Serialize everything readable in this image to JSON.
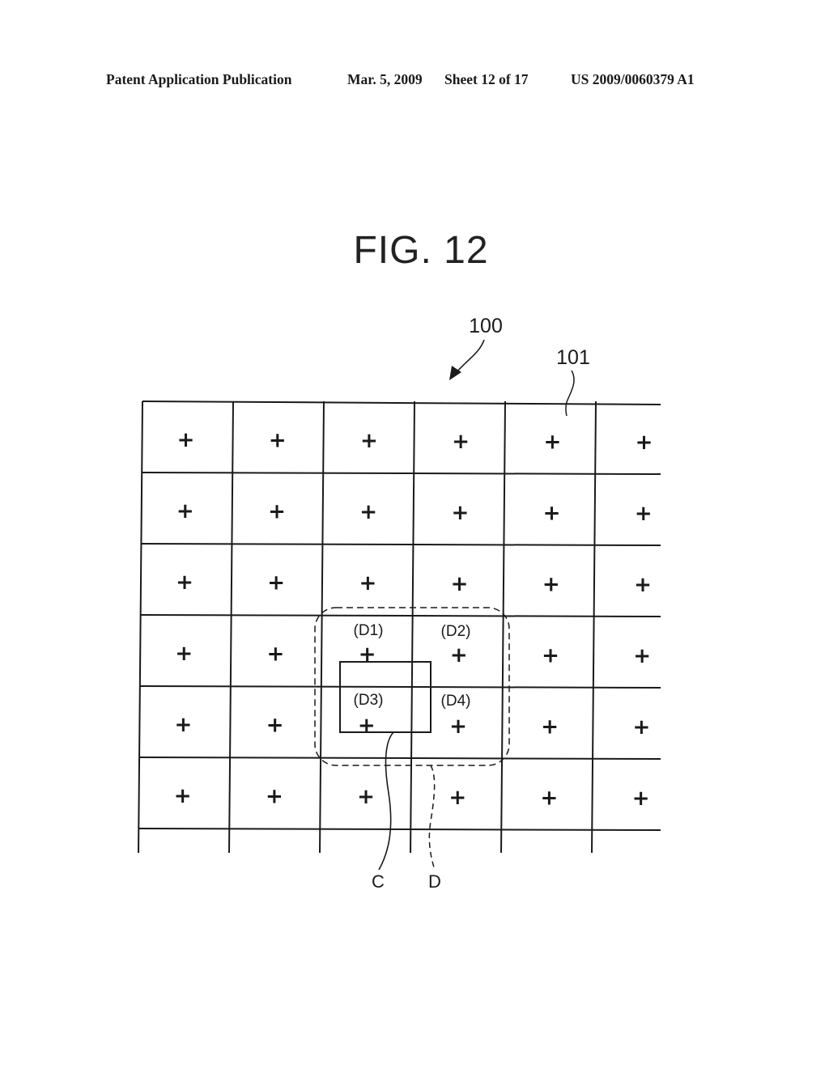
{
  "header": {
    "publication": "Patent Application Publication",
    "date": "Mar. 5, 2009",
    "sheet": "Sheet 12 of 17",
    "number": "US 2009/0060379 A1"
  },
  "figure": {
    "title": "FIG. 12",
    "grid": {
      "rows": 6,
      "columns": 6,
      "cell_marker": "+",
      "extends_beyond_right_edge": true,
      "extends_beyond_bottom_edge": true
    },
    "reference_labels": {
      "device": "100",
      "pixel_cell": "101",
      "region_c": "C",
      "region_d": "D"
    },
    "cell_labels": [
      {
        "text": "(D1)",
        "row": 4,
        "column": 3
      },
      {
        "text": "(D2)",
        "row": 4,
        "column": 4
      },
      {
        "text": "(D3)",
        "row": 5,
        "column": 3
      },
      {
        "text": "(D4)",
        "row": 5,
        "column": 4
      }
    ],
    "region_c_style": "solid rectangle",
    "region_d_style": "dashed rounded rectangle"
  },
  "colors": {
    "ink": "#1a1a1a",
    "paper": "#ffffff"
  }
}
